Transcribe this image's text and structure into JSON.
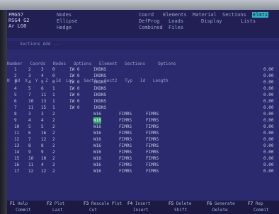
{
  "header": {
    "version": [
      "FMG57",
      "RSG4 G2",
      "Ar LG0"
    ],
    "menu_row1": [
      "Nodes",
      "Coord",
      "Elements",
      "Material",
      "Sections",
      "Elmts"
    ],
    "menu_row2": [
      "Ellipse",
      "DefProg",
      "Loads",
      "Display",
      "Lists"
    ],
    "menu_row3": [
      "Hedge",
      "Combined",
      "Files"
    ]
  },
  "toolbar": {
    "hint": "Sections  Add  ..."
  },
  "table_header": {
    "line1": "Number   Coords   Nodes   Options   Element   Sections     Options",
    "line2": "N  Nd  X   Y   Z   Id  Loc    Sect1   Sect2   Typ   Id   Length"
  },
  "rows": [
    [
      "1",
      "2",
      "3",
      "0",
      "IW 0",
      "IKDNS",
      "",
      "",
      "0.00"
    ],
    [
      "2",
      "3",
      "4",
      "0",
      "IW 0",
      "IKDNS",
      "",
      "",
      "0.00"
    ],
    [
      "3",
      "4",
      "5",
      "0",
      "IW 0",
      "IKDNS",
      "",
      "",
      "0.00"
    ],
    [
      "4",
      "5",
      "6",
      "1",
      "IW 0",
      "IKDNS",
      "",
      "",
      "0.00"
    ],
    [
      "5",
      "7",
      "11",
      "1",
      "IW 0",
      "IKDNS",
      "",
      "",
      "0.00"
    ],
    [
      "6",
      "10",
      "13",
      "1",
      "IW 0",
      "IKDNS",
      "",
      "",
      "0.00"
    ],
    [
      "7",
      "11",
      "15",
      "1",
      "IW 0",
      "IKDNS",
      "",
      "",
      "0.00"
    ],
    [
      "8",
      "3",
      "3",
      "2",
      "",
      "W16",
      "FIMRS",
      "FIMRS",
      "0.00"
    ],
    [
      "9",
      "4",
      "4",
      "2",
      "",
      "W16",
      "FIMRS",
      "FIMRS",
      "0.00"
    ],
    [
      "10",
      "5",
      "5",
      "2",
      "",
      "W16",
      "FIMRS",
      "FIMRS",
      "0.00"
    ],
    [
      "11",
      "6",
      "16",
      "2",
      "",
      "W16",
      "FIMRS",
      "FIMRS",
      "0.00"
    ],
    [
      "12",
      "7",
      "12",
      "2",
      "",
      "W16",
      "FIMRS",
      "FIMRS",
      "0.00"
    ],
    [
      "13",
      "8",
      "8",
      "2",
      "",
      "W16",
      "FIMRS",
      "FIMRS",
      "0.00"
    ],
    [
      "14",
      "9",
      "9",
      "2",
      "",
      "W16",
      "FIMRS",
      "FIMRS",
      "0.00"
    ],
    [
      "15",
      "10",
      "10",
      "2",
      "",
      "W16",
      "FIMRS",
      "FIMRS",
      "0.00"
    ],
    [
      "16",
      "11",
      "4",
      "2",
      "",
      "W16",
      "FIMRS",
      "FIMRS",
      "0.00"
    ],
    [
      "17",
      "12",
      "12",
      "2",
      "",
      "W16",
      "FIMRS",
      "FIMRS",
      "0.00"
    ]
  ],
  "function_keys": {
    "row1": [
      {
        "key": "F1",
        "label": "Help"
      },
      {
        "key": "F2",
        "label": "Plot"
      },
      {
        "key": "F3",
        "label": "Rescale Plot"
      },
      {
        "key": "F4",
        "label": "Insert"
      },
      {
        "key": "F5",
        "label": "Delete"
      },
      {
        "key": "F6",
        "label": "Generate"
      },
      {
        "key": "F7",
        "label": "Rep"
      }
    ],
    "row2": [
      "Commit",
      "Last",
      "Cut",
      "Insert",
      "Shift",
      "Delete",
      "Commit"
    ]
  },
  "colors": {
    "background": "#2b2a6e",
    "selection": "#2fa36a",
    "active_menu": "#39b3c8"
  }
}
